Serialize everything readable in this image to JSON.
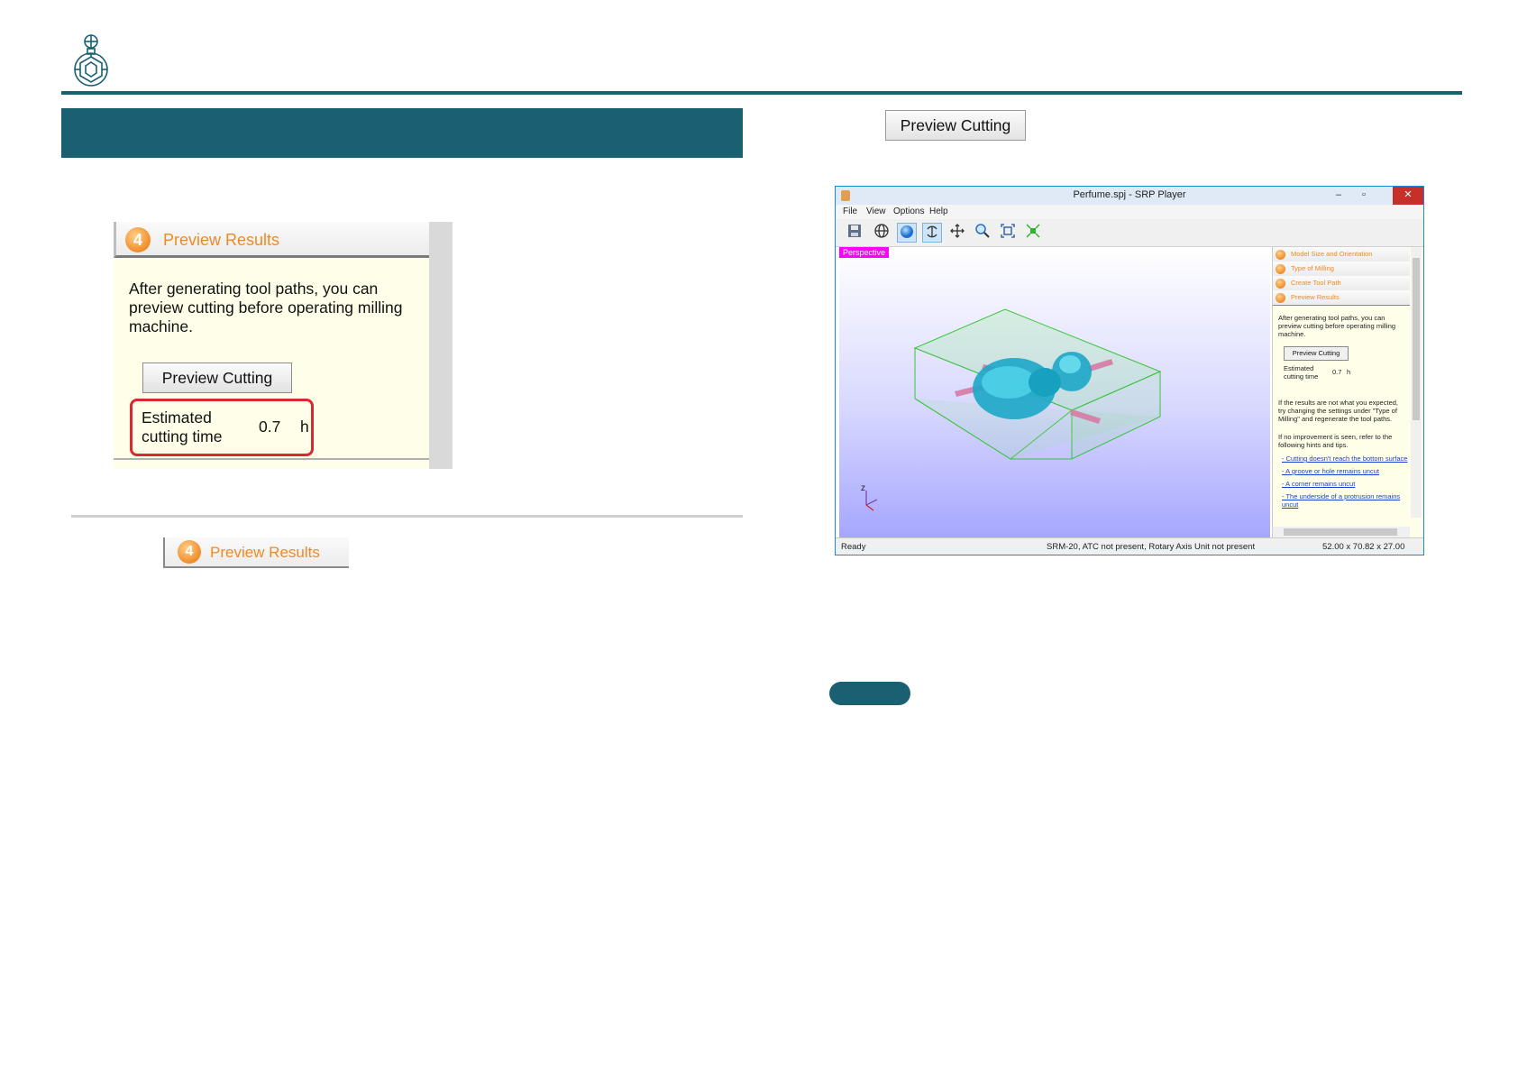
{
  "header": {
    "logo_icon": "perfume-bottle-icon",
    "accent_color": "#1a5f72"
  },
  "left_panel": {
    "step_number": "4",
    "step_title": "Preview Results",
    "description": "After generating tool paths, you can preview cutting before operating milling machine.",
    "preview_button": "Preview Cutting",
    "estimated_label": "Estimated cutting time",
    "estimated_value": "0.7",
    "estimated_unit": "h"
  },
  "step_tab": {
    "step_number": "4",
    "label": "Preview Results"
  },
  "right": {
    "preview_button": "Preview Cutting"
  },
  "window": {
    "title": "Perfume.spj - SRP Player",
    "menu": [
      "File",
      "View",
      "Options",
      "Help"
    ],
    "toolbar_icons": [
      "save-icon",
      "globe-icon",
      "sphere-icon",
      "rotate-icon",
      "pan-icon",
      "zoom-icon",
      "fit-icon",
      "center-icon"
    ],
    "viewport_label": "Perspective",
    "axis_label": "z",
    "side_panel": {
      "steps": [
        "Model Size and Orientation",
        "Type of Milling",
        "Create Tool Path",
        "Preview Results"
      ],
      "description": "After generating tool paths, you can preview cutting before operating milling machine.",
      "button": "Preview Cutting",
      "estimated_label": "Estimated cutting time",
      "estimated_value": "0.7",
      "estimated_unit": "h",
      "hint1": "If the results are not what you expected, try changing the settings under \"Type of Milling\" and regenerate the tool paths.",
      "hint2": "If no improvement is seen, refer to the following hints and tips.",
      "links": [
        "- Cutting doesn't reach the bottom surface",
        "- A groove or hole remains uncut",
        "- A corner remains uncut",
        "- The underside of a protrusion remains uncut"
      ]
    },
    "status": {
      "left": "Ready",
      "middle": "SRM-20, ATC not present, Rotary Axis Unit not present",
      "right": "52.00 x  70.82 x  27.00"
    }
  }
}
